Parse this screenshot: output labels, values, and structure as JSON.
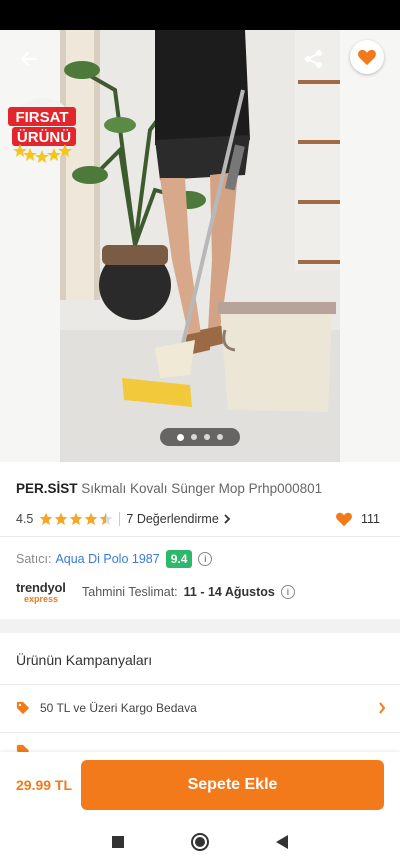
{
  "product": {
    "brand": "PER.SİST",
    "name": "Sıkmalı Kovalı Sünger Mop Prhp000801",
    "rating": "4.5",
    "review_text": "7 Değerlendirme",
    "favorite_count": "111",
    "badge_line1": "FIRSAT",
    "badge_line2": "ÜRÜNÜ",
    "gallery_pages": 4,
    "gallery_active_index": 0
  },
  "seller": {
    "label": "Satıcı:",
    "name": "Aqua Di Polo 1987",
    "score": "9.4"
  },
  "delivery": {
    "logo_main": "trendyol",
    "logo_sub": "express",
    "label": "Tahmini Teslimat:",
    "date": "11 - 14 Ağustos"
  },
  "campaigns": {
    "title": "Ürünün Kampanyaları",
    "items": [
      {
        "label": "50 TL ve Üzeri Kargo Bedava"
      }
    ]
  },
  "bottom": {
    "price": "29.99 TL",
    "add_label": "Sepete Ekle"
  },
  "icons": {
    "back": "arrow-left-icon",
    "share": "share-icon",
    "favorite": "heart-icon",
    "tag": "tag-icon",
    "chevron": "chevron-right-icon"
  },
  "colors": {
    "accent": "#f27a1a",
    "seller_link": "#3a7bd5",
    "score_badge": "#2eb86b",
    "star": "#f5a623"
  }
}
